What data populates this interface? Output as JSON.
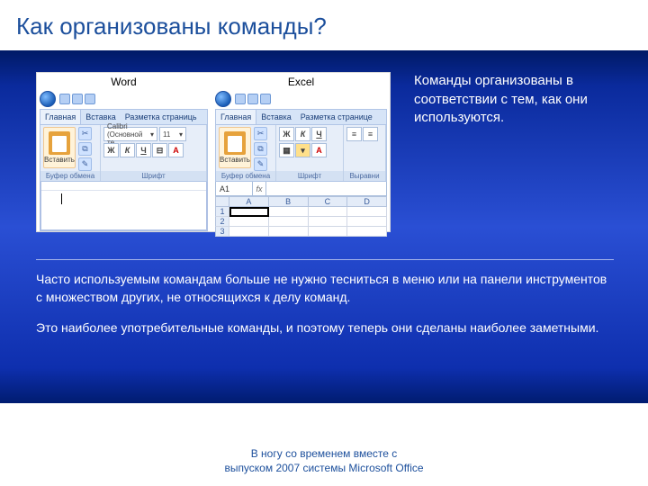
{
  "title": "Как организованы команды?",
  "description": "Команды организованы в соответствии с тем, как они используются.",
  "apps": {
    "word": {
      "name": "Word",
      "tabs": {
        "home": "Главная",
        "insert": "Вставка",
        "layout": "Разметка страниць"
      },
      "paste": "Вставить",
      "groups": {
        "clipboard": "Буфер обмена",
        "font": "Шрифт"
      },
      "font_name": "Calibri (Основной те",
      "font_size": "11"
    },
    "excel": {
      "name": "Excel",
      "tabs": {
        "home": "Главная",
        "insert": "Вставка",
        "layout": "Разметка странице"
      },
      "paste": "Вставить",
      "groups": {
        "clipboard": "Буфер обмена",
        "font": "Шрифт",
        "align": "Выравни"
      },
      "name_box": "A1",
      "cols": {
        "a": "A",
        "b": "B",
        "c": "C",
        "d": "D"
      },
      "rows": {
        "r1": "1",
        "r2": "2",
        "r3": "3"
      }
    }
  },
  "body": {
    "p1": "Часто используемым командам больше не нужно тесниться в меню или на панели инструментов с множеством других, не относящихся к делу команд.",
    "p2": "Это наиболее употребительные команды, и поэтому теперь они сделаны наиболее заметными."
  },
  "footer": {
    "l1": "В ногу со временем вместе с",
    "l2": "выпуском 2007 системы Microsoft Office"
  }
}
